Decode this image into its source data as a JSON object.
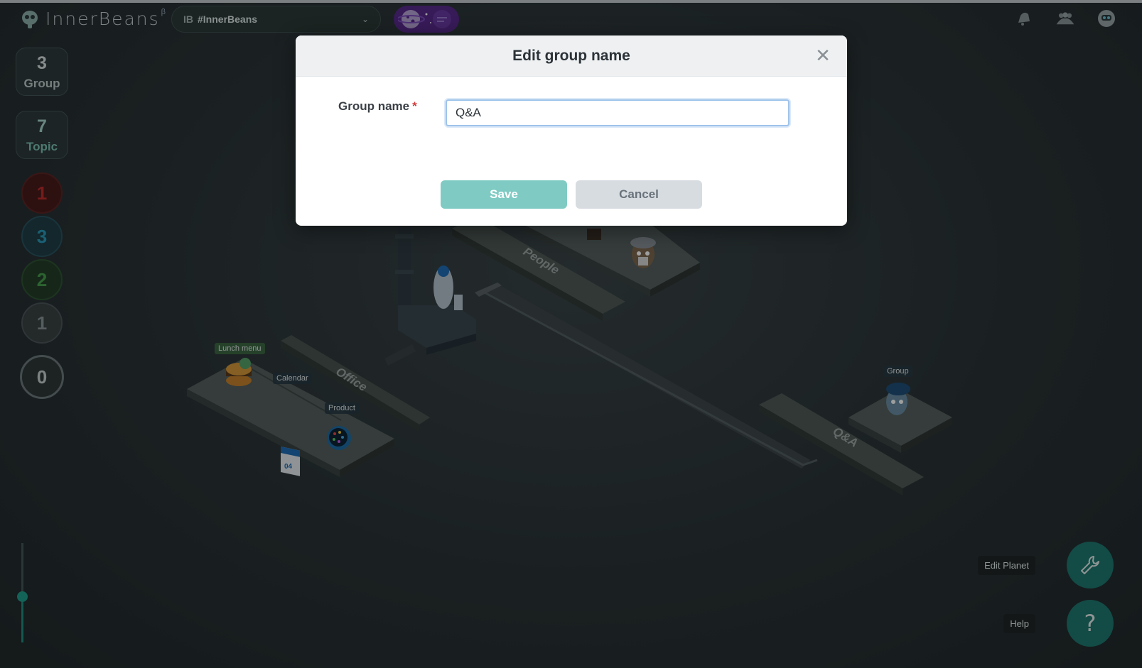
{
  "app": {
    "logo_text": "InnerBeans",
    "logo_beta": "β",
    "workspace": {
      "prefix": "IB",
      "name": "#InnerBeans"
    }
  },
  "sidebar": {
    "group_count": "3",
    "group_label": "Group",
    "topic_count": "7",
    "topic_label": "Topic",
    "status_counts": [
      {
        "value": "1",
        "color": "#c12d2d"
      },
      {
        "value": "3",
        "color": "#2a9cbc"
      },
      {
        "value": "2",
        "color": "#48a04e"
      },
      {
        "value": "1",
        "color": "#8b9799"
      }
    ],
    "zero_badge": "0"
  },
  "scene": {
    "zones": [
      "Office",
      "People",
      "Q&A"
    ],
    "topic_labels": [
      "Lunch menu",
      "Calendar",
      "Product",
      "Group"
    ],
    "calendar_day": "04"
  },
  "actions": {
    "edit_planet": "Edit Planet",
    "help": "Help"
  },
  "modal": {
    "title": "Edit group name",
    "field_label": "Group name",
    "required_mark": "*",
    "field_value": "Q&A",
    "save": "Save",
    "cancel": "Cancel"
  }
}
